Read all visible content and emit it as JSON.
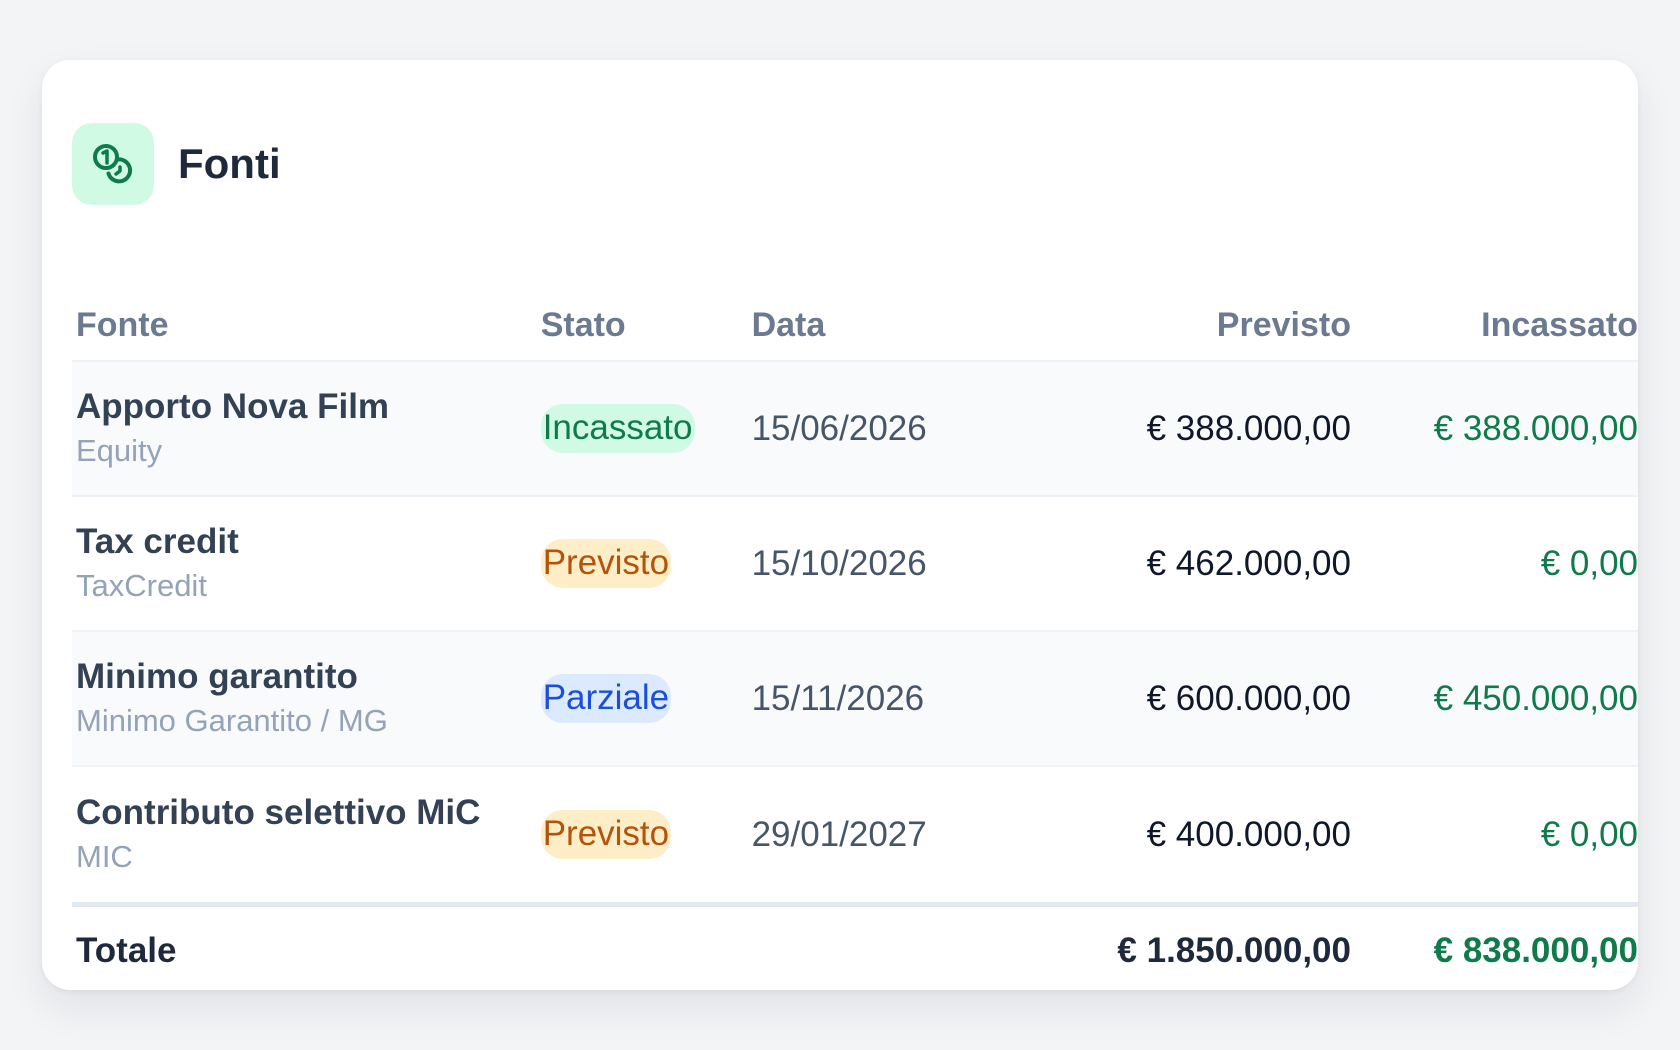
{
  "card": {
    "title": "Fonti",
    "icon": "coins-icon",
    "accent_color": "#0f7a4a"
  },
  "table": {
    "headers": {
      "fonte": "Fonte",
      "stato": "Stato",
      "data": "Data",
      "previsto": "Previsto",
      "incassato": "Incassato"
    },
    "rows": [
      {
        "name": "Apporto Nova Film",
        "type": "Equity",
        "status": "Incassato",
        "status_kind": "incassato",
        "date": "15/06/2026",
        "previsto": "€ 388.000,00",
        "incassato": "€ 388.000,00"
      },
      {
        "name": "Tax credit",
        "type": "TaxCredit",
        "status": "Previsto",
        "status_kind": "previsto",
        "date": "15/10/2026",
        "previsto": "€ 462.000,00",
        "incassato": "€ 0,00"
      },
      {
        "name": "Minimo garantito",
        "type": "Minimo Garantito / MG",
        "status": "Parziale",
        "status_kind": "parziale",
        "date": "15/11/2026",
        "previsto": "€ 600.000,00",
        "incassato": "€ 450.000,00"
      },
      {
        "name": "Contributo selettivo MiC",
        "type": "MIC",
        "status": "Previsto",
        "status_kind": "previsto",
        "date": "29/01/2027",
        "previsto": "€ 400.000,00",
        "incassato": "€ 0,00"
      }
    ],
    "total": {
      "label": "Totale",
      "previsto": "€ 1.850.000,00",
      "incassato": "€ 838.000,00"
    }
  },
  "status_colors": {
    "incassato": {
      "bg": "#d1fae5",
      "fg": "#0f7a4a"
    },
    "previsto": {
      "bg": "#fdeec7",
      "fg": "#b45309"
    },
    "parziale": {
      "bg": "#dbeafe",
      "fg": "#1d4ed8"
    }
  }
}
